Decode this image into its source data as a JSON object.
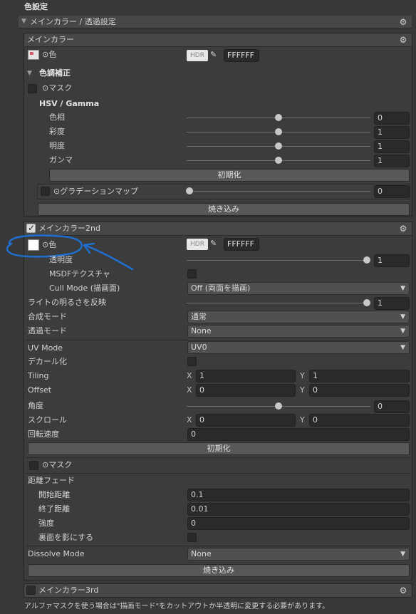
{
  "section_title": "色設定",
  "main_foldout": "メインカラー / 透過設定",
  "main_color": {
    "header": "メインカラー",
    "color_label": "⊙色",
    "hdr": "HDR",
    "hex": "FFFFFF",
    "tone_header": "色調補正",
    "mask_label": "⊙マスク",
    "hsv_header": "HSV / Gamma",
    "sliders": [
      {
        "label": "色相",
        "value": "0",
        "fraction": 0.5
      },
      {
        "label": "彩度",
        "value": "1",
        "fraction": 0.5
      },
      {
        "label": "明度",
        "value": "1",
        "fraction": 0.5
      },
      {
        "label": "ガンマ",
        "value": "1",
        "fraction": 0.5
      }
    ],
    "reset_button": "初期化",
    "gradient_label": "⊙グラデーションマップ",
    "gradient_value": "0",
    "gradient_fraction": 0.0,
    "bake_button": "焼き込み"
  },
  "main_color_2nd": {
    "header": "メインカラー2nd",
    "enabled": true,
    "color_label": "⊙色",
    "hdr": "HDR",
    "hex": "FFFFFF",
    "opacity_label": "透明度",
    "opacity_value": "1",
    "opacity_fraction": 1.0,
    "msdf_label": "MSDFテクスチャ",
    "cull_label": "Cull Mode (描画面)",
    "cull_value": "Off (両面を描画)",
    "light_label": "ライトの明るさを反映",
    "light_value": "1",
    "light_fraction": 1.0,
    "blend_label": "合成モード",
    "blend_value": "通常",
    "alpha_label": "透過モード",
    "alpha_value": "None",
    "uv_label": "UV Mode",
    "uv_value": "UV0",
    "decal_label": "デカール化",
    "tiling_label": "Tiling",
    "tiling_x": "1",
    "tiling_y": "1",
    "offset_label": "Offset",
    "offset_x": "0",
    "offset_y": "0",
    "angle_label": "角度",
    "angle_value": "0",
    "angle_fraction": 0.5,
    "scroll_label": "スクロール",
    "scroll_x": "0",
    "scroll_y": "0",
    "rotation_label": "回転速度",
    "rotation_value": "0",
    "reset_button": "初期化",
    "mask_label": "⊙マスク",
    "distance_fade_label": "距離フェード",
    "start_label": "開始距離",
    "start_value": "0.1",
    "end_label": "終了距離",
    "end_value": "0.01",
    "strength_label": "強度",
    "strength_value": "0",
    "backface_label": "裏面を影にする",
    "dissolve_label": "Dissolve Mode",
    "dissolve_value": "None",
    "bake_button": "焼き込み",
    "x_label": "X",
    "y_label": "Y"
  },
  "main_color_3rd": {
    "header": "メインカラー3rd",
    "enabled": false
  },
  "footer_note": "アルファマスクを使う場合は\"描画モード\"をカットアウトか半透明に変更する必要があります。",
  "colors": {
    "annotation": "#1f6fd1",
    "background": "#383838"
  }
}
